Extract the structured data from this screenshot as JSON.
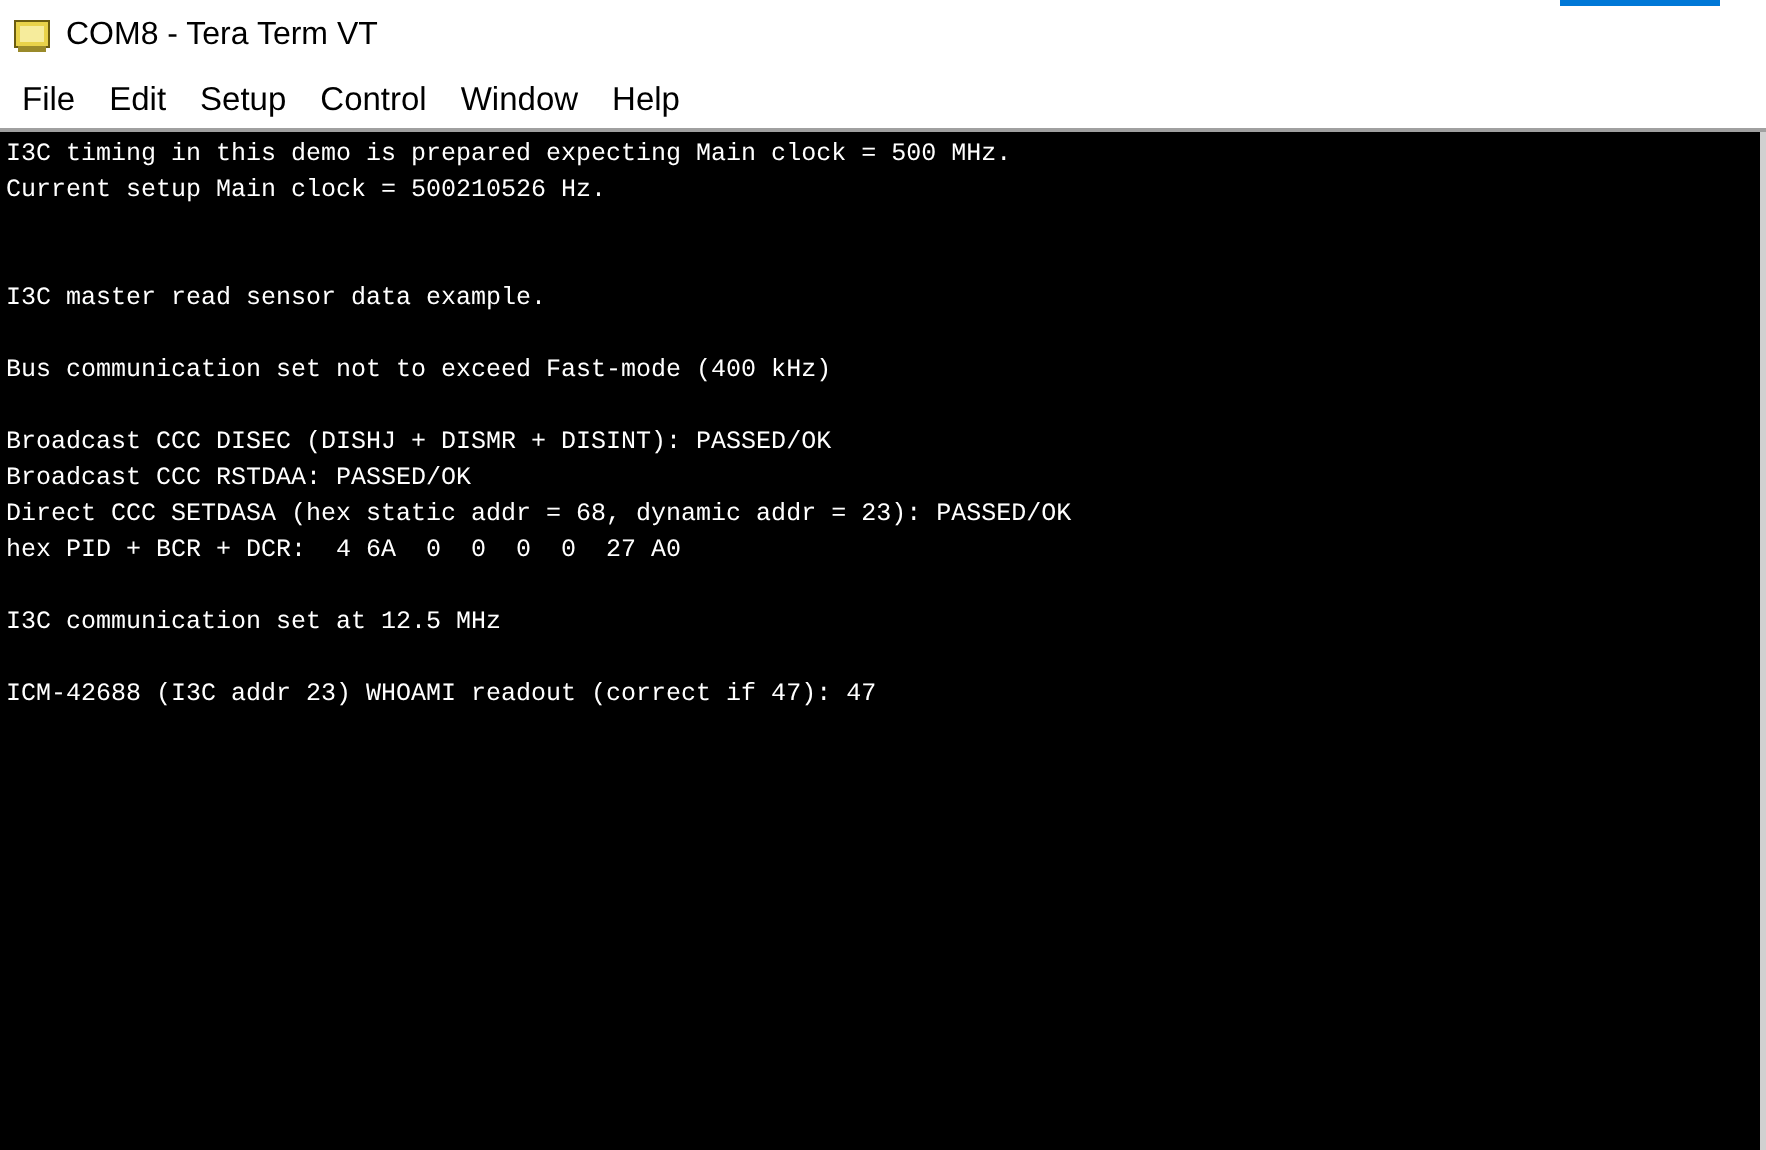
{
  "window": {
    "title": "COM8 - Tera Term VT"
  },
  "menu": [
    "File",
    "Edit",
    "Setup",
    "Control",
    "Window",
    "Help"
  ],
  "terminal": {
    "rows": [
      {
        "kind": "line",
        "text": "I3C timing in this demo is prepared expecting Main clock = 500 MHz."
      },
      {
        "kind": "line",
        "text": "Current setup Main clock = 500210526 Hz."
      },
      {
        "kind": "blank"
      },
      {
        "kind": "blank"
      },
      {
        "kind": "line",
        "text": "I3C master read sensor data example."
      },
      {
        "kind": "blank"
      },
      {
        "kind": "line",
        "text": "Bus communication set not to exceed Fast-mode (400 kHz)"
      },
      {
        "kind": "blank"
      },
      {
        "kind": "line",
        "text": "Broadcast CCC DISEC (DISHJ + DISMR + DISINT): PASSED/OK"
      },
      {
        "kind": "line",
        "text": "Broadcast CCC RSTDAA: PASSED/OK"
      },
      {
        "kind": "line",
        "text": "Direct CCC SETDASA (hex static addr = 68, dynamic addr = 23): PASSED/OK"
      },
      {
        "kind": "line",
        "text": "hex PID + BCR + DCR:  4 6A  0  0  0  0  27 A0"
      },
      {
        "kind": "blank"
      },
      {
        "kind": "line",
        "text": "I3C communication set at 12.5 MHz"
      },
      {
        "kind": "blank"
      },
      {
        "kind": "line",
        "text": "ICM-42688 (I3C addr 23) WHOAMI readout (correct if 47): 47"
      }
    ]
  }
}
